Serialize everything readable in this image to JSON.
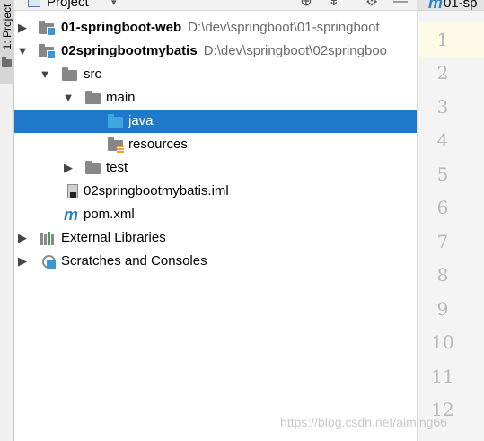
{
  "toolwindow": {
    "tab_label": "1: Project"
  },
  "header": {
    "title": "Project",
    "icons": [
      "locate-icon",
      "collapse-icon",
      "gear-icon",
      "hide-icon"
    ]
  },
  "tree": [
    {
      "arrow": "▶",
      "icon": "module-folder-icon",
      "label": "01-springboot-web",
      "path": "D:\\dev\\springboot\\01-springboot"
    },
    {
      "arrow": "▼",
      "icon": "module-folder-icon",
      "label": "02springbootmybatis",
      "path": "D:\\dev\\springboot\\02springboo"
    },
    {
      "arrow": "▼",
      "icon": "folder-icon",
      "label": "src"
    },
    {
      "arrow": "▼",
      "icon": "folder-icon",
      "label": "main"
    },
    {
      "arrow": "",
      "icon": "source-folder-icon",
      "label": "java",
      "selected": true
    },
    {
      "arrow": "",
      "icon": "resources-folder-icon",
      "label": "resources"
    },
    {
      "arrow": "▶",
      "icon": "folder-icon",
      "label": "test"
    },
    {
      "arrow": "",
      "icon": "iml-file-icon",
      "label": "02springbootmybatis.iml"
    },
    {
      "arrow": "",
      "icon": "maven-icon",
      "label": "pom.xml"
    },
    {
      "arrow": "▶",
      "icon": "libraries-icon",
      "label": "External Libraries"
    },
    {
      "arrow": "▶",
      "icon": "scratches-icon",
      "label": "Scratches and Consoles"
    }
  ],
  "editor": {
    "tab_label": "01-sp",
    "line_numbers": [
      "1",
      "2",
      "3",
      "4",
      "5",
      "6",
      "7",
      "8",
      "9",
      "10",
      "11",
      "12"
    ]
  },
  "watermark": "https://blog.csdn.net/aiming66",
  "colors": {
    "selection": "#1e7ac8",
    "current_line": "#fdfbe6",
    "folder_gray": "#878787",
    "source_blue": "#40a6e0"
  }
}
